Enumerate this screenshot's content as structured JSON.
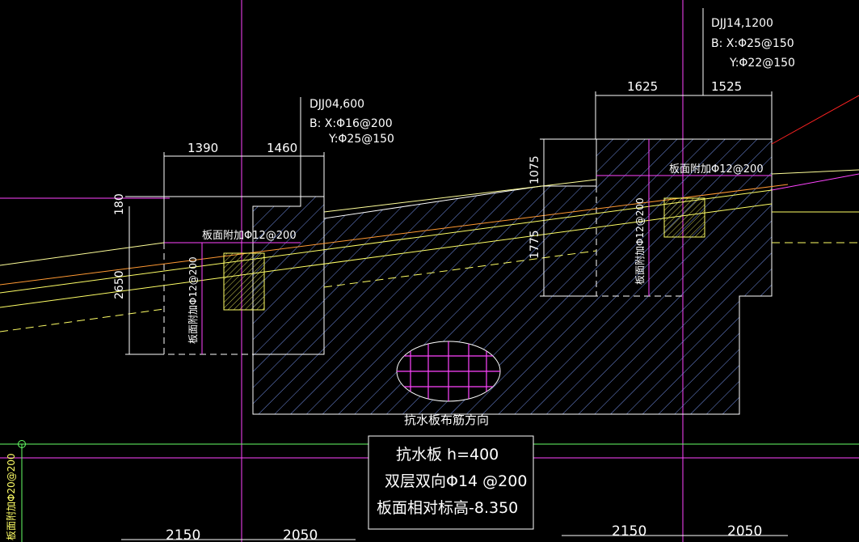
{
  "footings": [
    {
      "label": "DJJ04,600",
      "line_b": "B: X:Φ16@200",
      "line_y": "Y:Φ25@150",
      "dim_left": "1390",
      "dim_right": "1460",
      "dim_top": "180",
      "dim_height": "2650",
      "side_note_h": "板面附加Φ12@200",
      "side_note_v": "板面附加Φ12@200"
    },
    {
      "label": "DJJ14,1200",
      "line_b": "B: X:Φ25@150",
      "line_y": "Y:Φ22@150",
      "dim_left": "1625",
      "dim_right": "1525",
      "dim_upper": "1075",
      "dim_lower": "1775",
      "side_note_h": "板面附加Φ12@200",
      "side_note_v": "板面附加Φ12@200"
    }
  ],
  "slab": {
    "direction_note": "抗水板布筋方向",
    "title": "抗水板 h=400",
    "line2": "双层双向Φ14 @200",
    "line3": "板面相对标高-8.350"
  },
  "bottom_dims": [
    "2150",
    "2050",
    "2150",
    "2050"
  ],
  "left_edge_note": "板面附加Φ20@200",
  "colors": {
    "background": "#000000",
    "outline": "#ffffff",
    "hatch": "#7f9fff",
    "axis": "#ff44ff",
    "dimension": "#ffffff",
    "slab_line": "#ffff66",
    "grade_line": "#ff9933",
    "section_hatch": "#ffff66",
    "axis_green": "#66ff66",
    "red_line": "#ff2222"
  }
}
